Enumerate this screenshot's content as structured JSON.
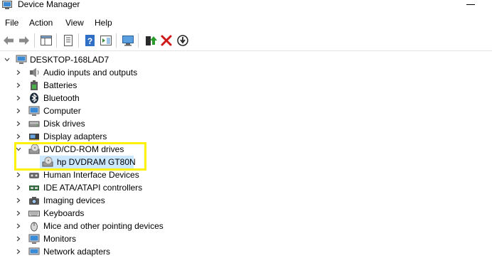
{
  "window": {
    "title": "Device Manager"
  },
  "menu": {
    "items": [
      "File",
      "Action",
      "View",
      "Help"
    ]
  },
  "tree": {
    "root": "DESKTOP-168LAD7",
    "categories": [
      "Audio inputs and outputs",
      "Batteries",
      "Bluetooth",
      "Computer",
      "Disk drives",
      "Display adapters",
      "DVD/CD-ROM drives",
      "Human Interface Devices",
      "IDE ATA/ATAPI controllers",
      "Imaging devices",
      "Keyboards",
      "Mice and other pointing devices",
      "Monitors",
      "Network adapters"
    ],
    "expanded_child": "hp DVDRAM GT80N"
  },
  "colors": {
    "selection": "#cce8ff",
    "highlight_box": "#fff200"
  }
}
